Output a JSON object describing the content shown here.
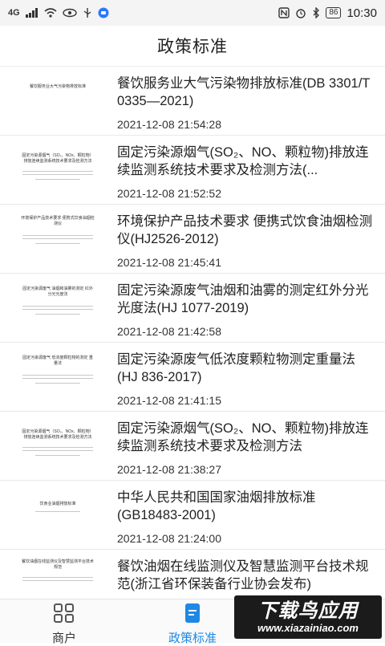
{
  "status_bar": {
    "network_label": "4G",
    "battery": "86",
    "time": "10:30"
  },
  "header": {
    "title": "政策标准"
  },
  "list": [
    {
      "thumb_title": "餐饮服务业大气污染物排放标准",
      "title": "餐饮服务业大气污染物排放标准(DB 3301/T 0335—2021)",
      "date": "2021-12-08 21:54:28"
    },
    {
      "thumb_title": "固定污染源烟气（SO₂、NOx、颗粒物）排放连续监测系统技术要求及检测方法",
      "title": "固定污染源烟气(SO₂、NO、颗粒物)排放连续监测系统技术要求及检测方法(...",
      "date": "2021-12-08 21:52:52"
    },
    {
      "thumb_title": "环境保护产品技术要求 便携式饮食油烟检测仪",
      "title": "环境保护产品技术要求 便携式饮食油烟检测仪(HJ2526-2012)",
      "date": "2021-12-08 21:45:41"
    },
    {
      "thumb_title": "固定污染源废气 油烟和油雾的测定 红外分光光度法",
      "title": "固定污染源废气油烟和油雾的测定红外分光光度法(HJ 1077-2019)",
      "date": "2021-12-08 21:42:58"
    },
    {
      "thumb_title": "固定污染源废气 低浓度颗粒物的测定 重量法",
      "title": "固定污染源废气低浓度颗粒物测定重量法(HJ 836-2017)",
      "date": "2021-12-08 21:41:15"
    },
    {
      "thumb_title": "固定污染源烟气（SO₂、NOx、颗粒物）排放连续监测系统技术要求及检测方法",
      "title": "固定污染源烟气(SO₂、NO、颗粒物)排放连续监测系统技术要求及检测方法",
      "date": "2021-12-08 21:38:27"
    },
    {
      "thumb_title": "饮食业油烟排放标准",
      "title": "中华人民共和国国家油烟排放标准(GB18483-2001)",
      "date": "2021-12-08 21:24:00"
    },
    {
      "thumb_title": "餐饮油烟在线监测仪及智慧监测平台技术规范",
      "title": "餐饮油烟在线监测仪及智慧监测平台技术规范(浙江省环保装备行业协会发布)",
      "date": ""
    }
  ],
  "bottom_nav": {
    "tabs": [
      {
        "label": "商户",
        "icon": "grid-icon",
        "active": false
      },
      {
        "label": "政策标准",
        "icon": "document-icon",
        "active": true
      }
    ]
  },
  "watermark": {
    "cn": "下载鸟应用",
    "url": "www.xiazainiao.com"
  },
  "colors": {
    "accent": "#1e88e5",
    "text": "#222222",
    "divider": "#e8e8e8"
  }
}
